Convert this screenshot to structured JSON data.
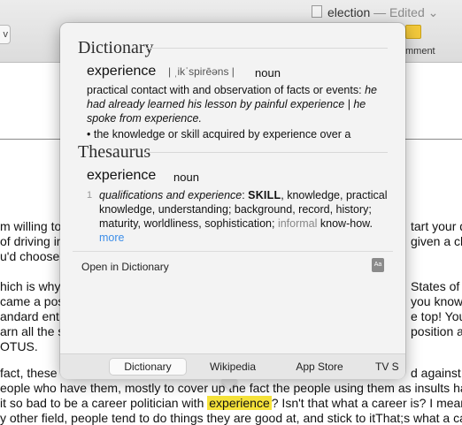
{
  "window": {
    "title": "election",
    "status": "— Edited",
    "comment_label": "mment",
    "left_tool": "v"
  },
  "document": {
    "lines": [
      "m willing to",
      "of driving in a",
      "u'd choose",
      "hich is why",
      "came a pos",
      "andard entry",
      "arn all the s",
      "OTUS.",
      "fact, these",
      "eople who have them, mostly to cover up the fact the people using them as insults have",
      "it so bad to be a career politician with",
      "y other field, people tend to do things they are good at, and stick to itThat;s what a car"
    ],
    "right_lines": [
      "tart your da",
      "given a cho",
      "States of A",
      "you know, lik",
      "e top! You c",
      "position as",
      "d against t"
    ],
    "highlight_word": "experience",
    "after_highlight": "? Isn't that what a career is? I mean j"
  },
  "popover": {
    "dictionary": {
      "heading": "Dictionary",
      "headword": "experience",
      "pronunciation": "| ˌikˈspirēəns |",
      "pos": "noun",
      "def1_plain": "practical contact with and observation of facts or events: ",
      "def1_example": "he had already learned his lesson by painful experience | he spoke from experience.",
      "def2": "• the knowledge or skill acquired by experience over a"
    },
    "thesaurus": {
      "heading": "Thesaurus",
      "headword": "experience",
      "pos": "noun",
      "num": "1",
      "sense": "qualifications and experience",
      "colon": ": ",
      "key_syn": "SKILL",
      "synonyms": ", knowledge, practical knowledge, understanding; background, record, history; maturity, worldliness, sophistication;",
      "informal_label": "informal",
      "informal_syn": "know-how.",
      "more": "more"
    },
    "open_link": "Open in Dictionary",
    "dict_icon": "Aa",
    "tabs": [
      "Dictionary",
      "Wikipedia",
      "App Store",
      "TV S"
    ]
  }
}
